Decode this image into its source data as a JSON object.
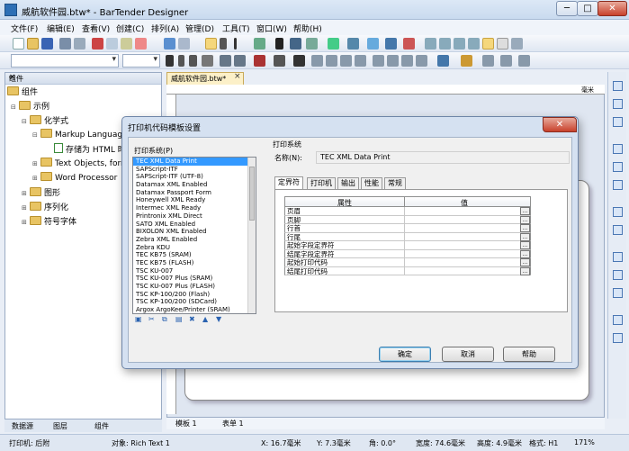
{
  "window": {
    "title": "威航软件园.btw* - BarTender Designer",
    "controls": {
      "minimize": "─",
      "maximize": "□",
      "close": "✕"
    }
  },
  "menu": [
    "文件(F)",
    "编辑(E)",
    "查看(V)",
    "创建(C)",
    "排列(A)",
    "管理(D)",
    "工具(T)",
    "窗口(W)",
    "帮助(H)"
  ],
  "left_panel": {
    "title": "组件",
    "pin": "ᵖ",
    "close": "×",
    "tree": [
      {
        "label": "组件",
        "level": 0,
        "expander": ""
      },
      {
        "label": "示例",
        "level": 1,
        "expander": "⊟"
      },
      {
        "label": "化学式",
        "level": 2,
        "expander": "⊟"
      },
      {
        "label": "Markup Language",
        "level": 3,
        "expander": "⊟"
      },
      {
        "label": "存储为 HTML 时",
        "level": 4,
        "expander": ""
      },
      {
        "label": "Text Objects, form",
        "level": 3,
        "expander": "⊞"
      },
      {
        "label": "Word Processor",
        "level": 3,
        "expander": "⊞"
      },
      {
        "label": "图形",
        "level": 2,
        "expander": "⊞"
      },
      {
        "label": "序列化",
        "level": 2,
        "expander": "⊞"
      },
      {
        "label": "符号字体",
        "level": 2,
        "expander": "⊞"
      }
    ],
    "bottom_tabs": [
      "数据源",
      "图层",
      "组件"
    ]
  },
  "document": {
    "tab_label": "威航软件园.btw*",
    "tab_close": "×",
    "ruler_unit": "毫米",
    "sheet_tabs": [
      "模板 1",
      "表单 1"
    ]
  },
  "dialog": {
    "title": "打印机代码模板设置",
    "close": "✕",
    "list_label": "打印系统(P)",
    "selected_index": 0,
    "printers": [
      "TEC XML Data Print",
      "SAPScript-ITF",
      "SAPScript-ITF (UTF-8)",
      "Datamax XML Enabled",
      "Datamax Passport Form",
      "Honeywell XML Ready",
      "Intermec XML Ready",
      "Printronix XML Direct",
      "SATO XML Enabled",
      "BIXOLON XML Enabled",
      "Zebra XML Enabled",
      "Zebra KDU",
      "TEC KB75 (SRAM)",
      "TEC KB75 (FLASH)",
      "TSC KU-007",
      "TSC KU-007 Plus (SRAM)",
      "TSC KU-007 Plus (FLASH)",
      "TSC KP-100/200 (Flash)",
      "TSC KP-100/200 (SDCard)",
      "Argox ArgoKee/Printer (SRAM)"
    ],
    "group_label": "打印系统",
    "name_label": "名称(N):",
    "name_value": "TEC XML Data Print",
    "tabs": [
      "定界符",
      "打印机",
      "输出",
      "性能",
      "常规"
    ],
    "grid": {
      "headers": [
        "属性",
        "值"
      ],
      "rows": [
        "页眉",
        "页脚",
        "行首",
        "行尾",
        "起始字段定界符",
        "结尾字段定界符",
        "起始打印代码",
        "结尾打印代码"
      ],
      "ellipsis": "..."
    },
    "buttons": {
      "ok": "确定",
      "cancel": "取消",
      "help": "帮助"
    }
  },
  "status": {
    "printer": "打印机: 后附",
    "object": "对象: Rich Text 1",
    "x": "X: 16.7毫米",
    "y": "Y: 7.3毫米",
    "angle": "角: 0.0°",
    "width": "宽度: 74.6毫米",
    "height": "高度: 4.9毫米",
    "format": "格式: H1",
    "zoom": "171%"
  }
}
